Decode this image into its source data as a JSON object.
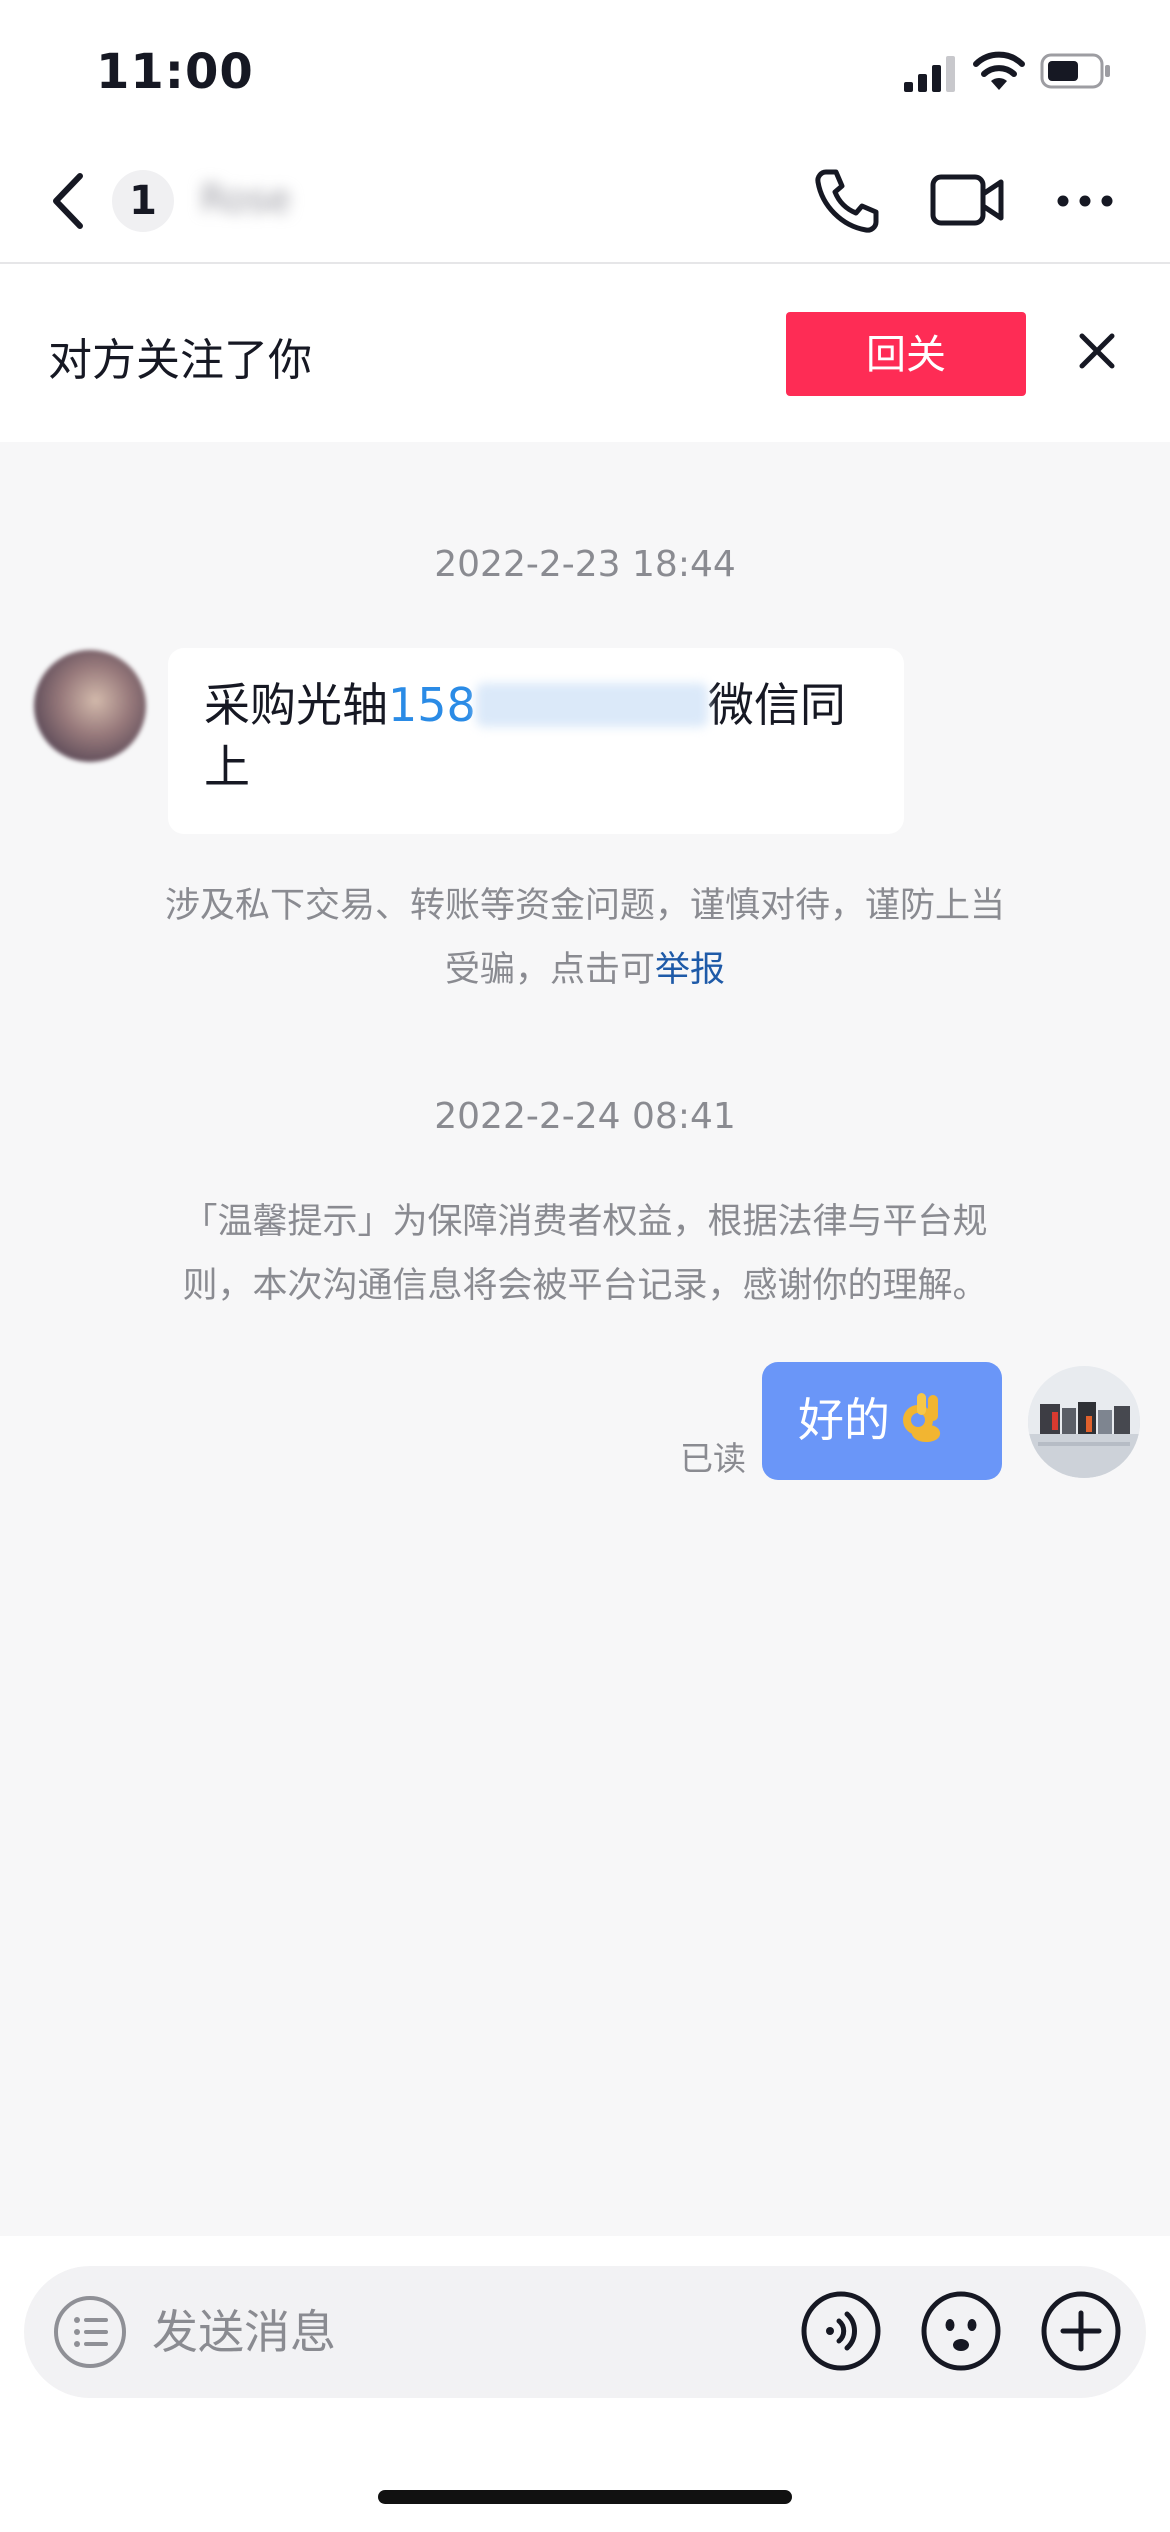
{
  "status_bar": {
    "time": "11:00"
  },
  "nav": {
    "unread_count": "1",
    "contact_name": "Rose"
  },
  "follow_banner": {
    "text": "对方关注了你",
    "button_label": "回关"
  },
  "messages": [
    {
      "timestamp": "2022-2-23 18:44",
      "from": "other",
      "text_prefix": "采购光轴",
      "phone_visible": "158",
      "text_suffix": "微信同上"
    },
    {
      "warning_text": "涉及私下交易、转账等资金问题，谨慎对待，谨防上当受骗，点击可",
      "report_link": "举报"
    },
    {
      "timestamp": "2022-2-24 08:41",
      "tip": "「温馨提示」为保障消费者权益，根据法律与平台规则，本次沟通信息将会被平台记录，感谢你的理解。"
    },
    {
      "from": "me",
      "text": "好的",
      "emoji": "ok-hand",
      "read_status": "已读"
    }
  ],
  "input": {
    "placeholder": "发送消息"
  },
  "colors": {
    "follow_button": "#fe2c55",
    "my_bubble": "#6a96f8",
    "link": "#2a8be6",
    "report_link": "#1e5aa8",
    "background": "#f7f7f8"
  }
}
